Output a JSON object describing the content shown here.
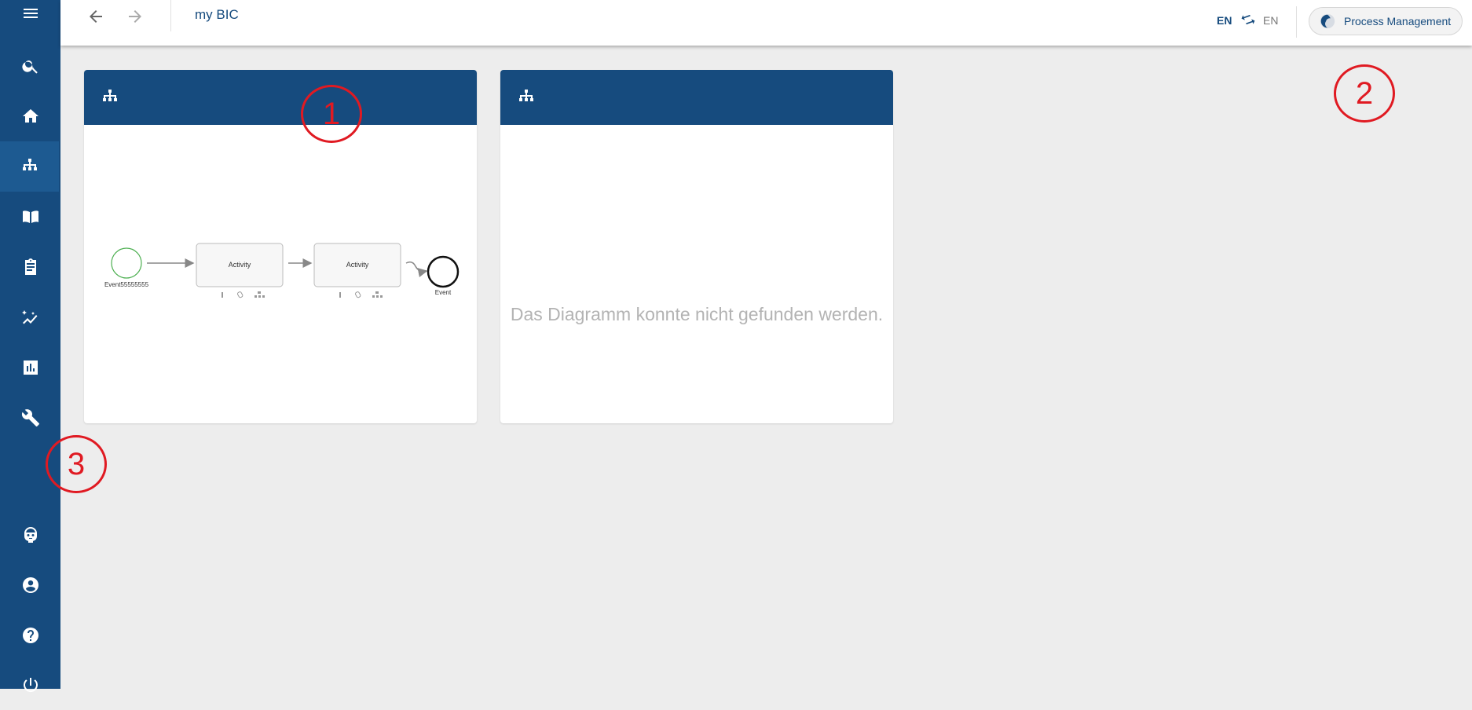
{
  "topbar": {
    "title": "my BIC",
    "lang_primary": "EN",
    "lang_secondary": "EN",
    "stage_button": "Process Management"
  },
  "sidebar": {
    "items": [
      "menu-icon",
      "search-icon",
      "home-icon",
      "sitemap-icon",
      "book-icon",
      "clipboard-icon",
      "analytics-icon",
      "chart-icon",
      "wrench-icon",
      "robot-icon",
      "account-icon",
      "help-icon",
      "power-icon"
    ],
    "active": "sitemap-icon"
  },
  "cards": [
    {
      "icon": "sitemap-icon",
      "diagram": {
        "start_event": "Event55555555",
        "activity_1": "Activity",
        "activity_2": "Activity",
        "end_event": "Event"
      }
    },
    {
      "icon": "sitemap-icon",
      "message": "Das Diagramm konnte nicht gefunden werden."
    }
  ],
  "annotations": [
    "1",
    "2",
    "3"
  ],
  "colors": {
    "primary": "#164b7e",
    "annotation": "#e01a22",
    "background": "#ededed"
  }
}
